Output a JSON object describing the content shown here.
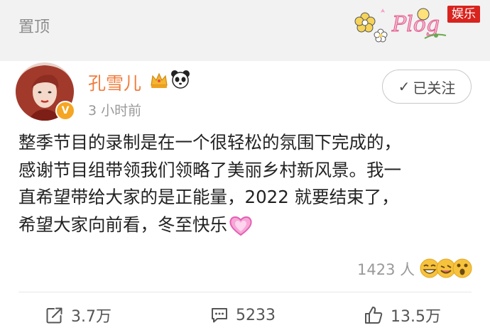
{
  "header": {
    "pin_label": "置顶",
    "plog_text": "Plog",
    "badge_label": "娱乐"
  },
  "post": {
    "username": "孔雪儿",
    "time": "3 小时前",
    "follow_label": "已关注",
    "text": "整季节目的录制是在一个很轻松的氛围下完成的，感谢节目组带领我们领略了美丽乡村新风景。我一直希望带给大家的是正能量，2022 就要结束了，希望大家向前看，冬至快乐",
    "text_lines": [
      "整季节目的录制是在一个很轻松的氛围下完成的，",
      "感谢节目组带领我们领略了美丽乡村新风景。我一",
      "直希望带给大家的是正能量，2022 就要结束了，",
      "希望大家向前看，冬至快乐"
    ],
    "reaction_count": "1423 人"
  },
  "actions": {
    "repost": "3.7万",
    "comment": "5233",
    "like": "13.5万"
  },
  "icons": {
    "verified": "verified-v-badge-icon",
    "crown": "crown-icon",
    "panda": "panda-icon",
    "heart": "pink-heart-icon",
    "repost": "share-icon",
    "comment": "comment-icon",
    "like": "thumbs-up-icon"
  },
  "colors": {
    "username": "#f07c3c",
    "badge": "#d9231e",
    "verified": "#f5a623"
  }
}
